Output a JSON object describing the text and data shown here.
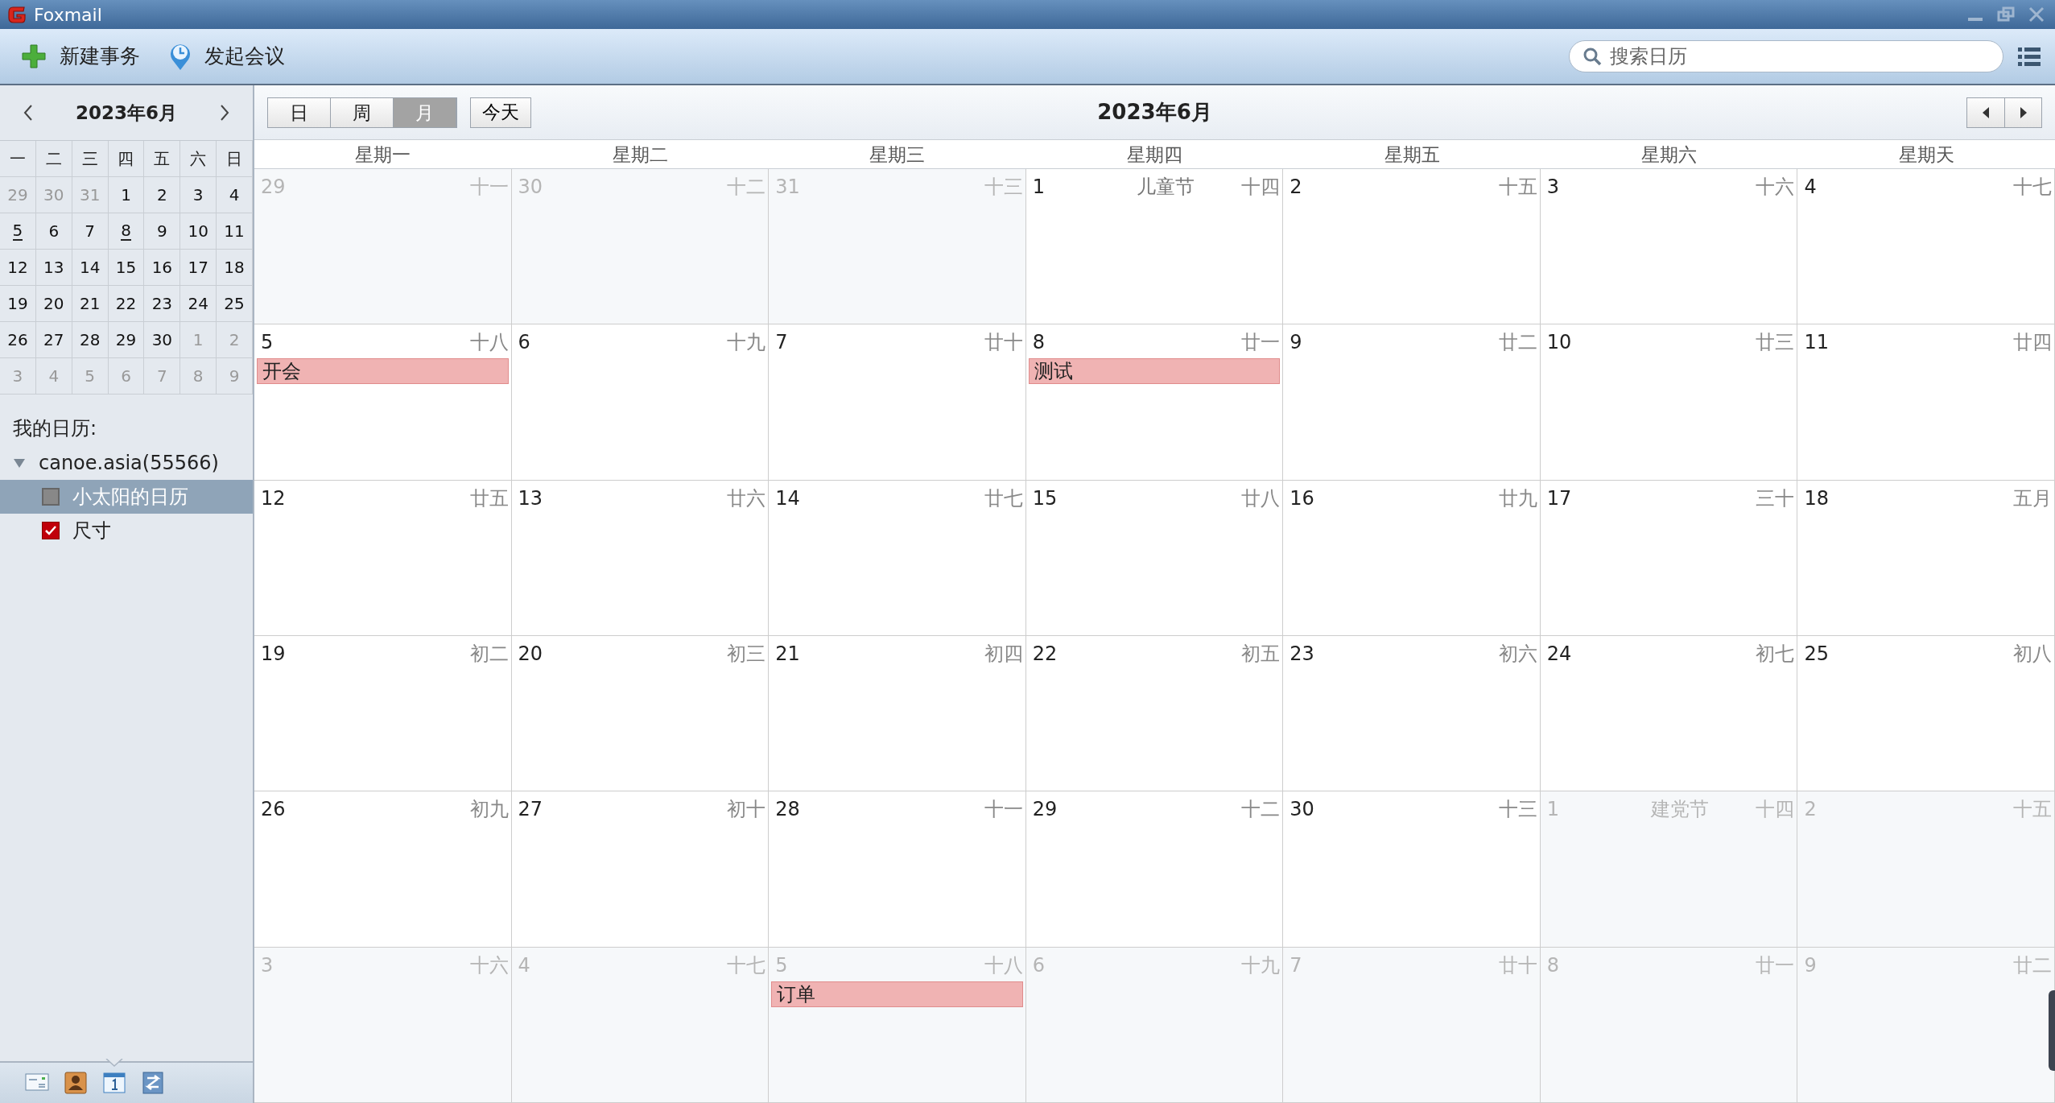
{
  "window": {
    "title": "Foxmail"
  },
  "toolbar": {
    "buttons": [
      {
        "kind": "new",
        "label": "新建事务"
      },
      {
        "kind": "meeting",
        "label": "发起会议"
      }
    ],
    "search": {
      "placeholder": "搜索日历"
    }
  },
  "mini_calendar": {
    "title": "2023年6月",
    "weekdays": [
      "一",
      "二",
      "三",
      "四",
      "五",
      "六",
      "日"
    ],
    "weeks": [
      [
        {
          "day": "29",
          "other": true,
          "marked": false
        },
        {
          "day": "30",
          "other": true,
          "marked": false
        },
        {
          "day": "31",
          "other": true,
          "marked": false
        },
        {
          "day": "1",
          "other": false,
          "marked": false
        },
        {
          "day": "2",
          "other": false,
          "marked": false
        },
        {
          "day": "3",
          "other": false,
          "marked": false
        },
        {
          "day": "4",
          "other": false,
          "marked": false
        }
      ],
      [
        {
          "day": "5",
          "other": false,
          "marked": true
        },
        {
          "day": "6",
          "other": false,
          "marked": false
        },
        {
          "day": "7",
          "other": false,
          "marked": false
        },
        {
          "day": "8",
          "other": false,
          "marked": true
        },
        {
          "day": "9",
          "other": false,
          "marked": false
        },
        {
          "day": "10",
          "other": false,
          "marked": false
        },
        {
          "day": "11",
          "other": false,
          "marked": false
        }
      ],
      [
        {
          "day": "12",
          "other": false,
          "marked": false
        },
        {
          "day": "13",
          "other": false,
          "marked": false
        },
        {
          "day": "14",
          "other": false,
          "marked": false
        },
        {
          "day": "15",
          "other": false,
          "marked": false
        },
        {
          "day": "16",
          "other": false,
          "marked": false
        },
        {
          "day": "17",
          "other": false,
          "marked": false
        },
        {
          "day": "18",
          "other": false,
          "marked": false
        }
      ],
      [
        {
          "day": "19",
          "other": false,
          "marked": false
        },
        {
          "day": "20",
          "other": false,
          "marked": false
        },
        {
          "day": "21",
          "other": false,
          "marked": false
        },
        {
          "day": "22",
          "other": false,
          "marked": false
        },
        {
          "day": "23",
          "other": false,
          "marked": false
        },
        {
          "day": "24",
          "other": false,
          "marked": false
        },
        {
          "day": "25",
          "other": false,
          "marked": false
        }
      ],
      [
        {
          "day": "26",
          "other": false,
          "marked": false
        },
        {
          "day": "27",
          "other": false,
          "marked": false
        },
        {
          "day": "28",
          "other": false,
          "marked": false
        },
        {
          "day": "29",
          "other": false,
          "marked": false
        },
        {
          "day": "30",
          "other": false,
          "marked": false
        },
        {
          "day": "1",
          "other": true,
          "marked": false
        },
        {
          "day": "2",
          "other": true,
          "marked": false
        }
      ],
      [
        {
          "day": "3",
          "other": true,
          "marked": false
        },
        {
          "day": "4",
          "other": true,
          "marked": false
        },
        {
          "day": "5",
          "other": true,
          "marked": false
        },
        {
          "day": "6",
          "other": true,
          "marked": false
        },
        {
          "day": "7",
          "other": true,
          "marked": false
        },
        {
          "day": "8",
          "other": true,
          "marked": false
        },
        {
          "day": "9",
          "other": true,
          "marked": false
        }
      ]
    ]
  },
  "calendars": {
    "heading": "我的日历:",
    "accounts": [
      {
        "label": "canoe.asia(55566)",
        "expanded": true,
        "children": [
          {
            "label": "小太阳的日历",
            "checked": false,
            "selected": true
          },
          {
            "label": "尺寸",
            "checked": true,
            "selected": false
          }
        ]
      }
    ]
  },
  "bottom_tabs": [
    {
      "kind": "mail",
      "selected": false
    },
    {
      "kind": "contacts",
      "selected": false
    },
    {
      "kind": "calendar",
      "selected": true
    },
    {
      "kind": "sync",
      "selected": false
    }
  ],
  "view_tabs": [
    {
      "label": "日",
      "selected": false
    },
    {
      "label": "周",
      "selected": false
    },
    {
      "label": "月",
      "selected": true
    }
  ],
  "today_button": "今天",
  "month_title": "2023年6月",
  "weekdays": [
    "星期一",
    "星期二",
    "星期三",
    "星期四",
    "星期五",
    "星期六",
    "星期天"
  ],
  "weeks": [
    [
      {
        "day": "29",
        "lunar": "十一",
        "other": true
      },
      {
        "day": "30",
        "lunar": "十二",
        "other": true
      },
      {
        "day": "31",
        "lunar": "十三",
        "other": true
      },
      {
        "day": "1",
        "lunar": "十四",
        "festival": "儿童节",
        "other": false
      },
      {
        "day": "2",
        "lunar": "十五",
        "other": false
      },
      {
        "day": "3",
        "lunar": "十六",
        "other": false
      },
      {
        "day": "4",
        "lunar": "十七",
        "other": false
      }
    ],
    [
      {
        "day": "5",
        "lunar": "十八",
        "other": false,
        "events": [
          {
            "title": "开会"
          }
        ]
      },
      {
        "day": "6",
        "lunar": "十九",
        "other": false
      },
      {
        "day": "7",
        "lunar": "廿十",
        "other": false
      },
      {
        "day": "8",
        "lunar": "廿一",
        "other": false,
        "events": [
          {
            "title": "测试"
          }
        ]
      },
      {
        "day": "9",
        "lunar": "廿二",
        "other": false
      },
      {
        "day": "10",
        "lunar": "廿三",
        "other": false
      },
      {
        "day": "11",
        "lunar": "廿四",
        "other": false
      }
    ],
    [
      {
        "day": "12",
        "lunar": "廿五",
        "other": false
      },
      {
        "day": "13",
        "lunar": "廿六",
        "other": false
      },
      {
        "day": "14",
        "lunar": "廿七",
        "other": false
      },
      {
        "day": "15",
        "lunar": "廿八",
        "other": false
      },
      {
        "day": "16",
        "lunar": "廿九",
        "other": false
      },
      {
        "day": "17",
        "lunar": "三十",
        "other": false
      },
      {
        "day": "18",
        "lunar": "五月",
        "other": false
      }
    ],
    [
      {
        "day": "19",
        "lunar": "初二",
        "other": false
      },
      {
        "day": "20",
        "lunar": "初三",
        "other": false
      },
      {
        "day": "21",
        "lunar": "初四",
        "other": false
      },
      {
        "day": "22",
        "lunar": "初五",
        "other": false
      },
      {
        "day": "23",
        "lunar": "初六",
        "other": false
      },
      {
        "day": "24",
        "lunar": "初七",
        "other": false
      },
      {
        "day": "25",
        "lunar": "初八",
        "other": false
      }
    ],
    [
      {
        "day": "26",
        "lunar": "初九",
        "other": false
      },
      {
        "day": "27",
        "lunar": "初十",
        "other": false
      },
      {
        "day": "28",
        "lunar": "十一",
        "other": false
      },
      {
        "day": "29",
        "lunar": "十二",
        "other": false
      },
      {
        "day": "30",
        "lunar": "十三",
        "other": false
      },
      {
        "day": "1",
        "lunar": "十四",
        "festival": "建党节",
        "other": true
      },
      {
        "day": "2",
        "lunar": "十五",
        "other": true
      }
    ],
    [
      {
        "day": "3",
        "lunar": "十六",
        "other": true
      },
      {
        "day": "4",
        "lunar": "十七",
        "other": true
      },
      {
        "day": "5",
        "lunar": "十八",
        "other": true,
        "events": [
          {
            "title": "订单"
          }
        ]
      },
      {
        "day": "6",
        "lunar": "十九",
        "other": true
      },
      {
        "day": "7",
        "lunar": "廿十",
        "other": true
      },
      {
        "day": "8",
        "lunar": "廿一",
        "other": true
      },
      {
        "day": "9",
        "lunar": "廿二",
        "other": true
      }
    ]
  ]
}
